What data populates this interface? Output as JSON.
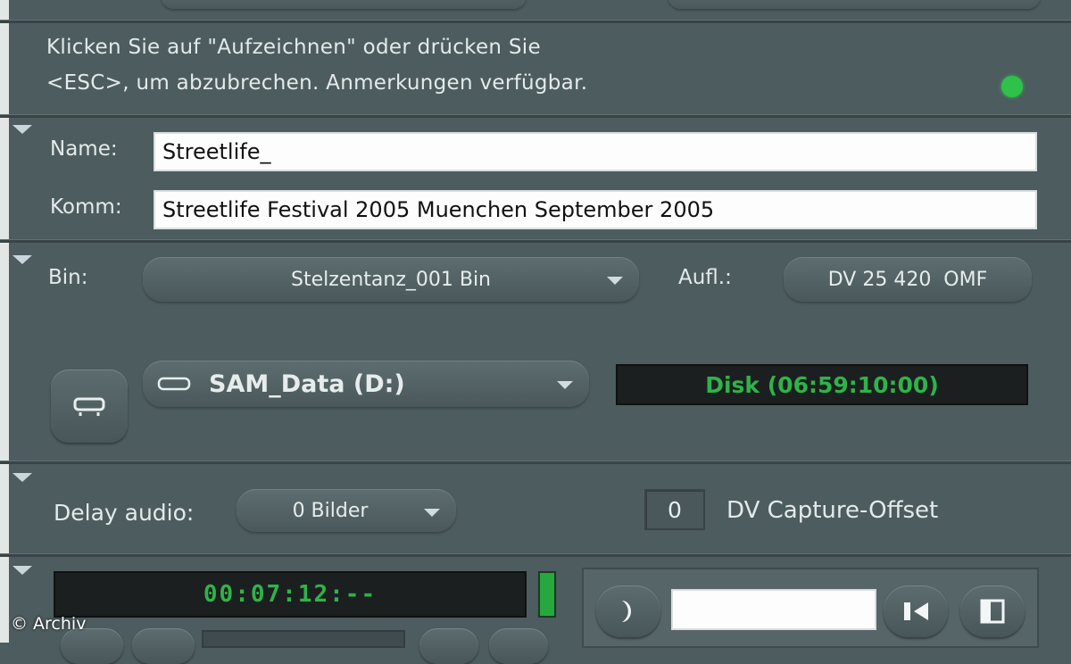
{
  "message": {
    "line1": "Klicken Sie auf \"Aufzeichnen\" oder drücken Sie",
    "line2": "<ESC>, um abzubrechen. Anmerkungen verfügbar."
  },
  "clip": {
    "name_label": "Name:",
    "name_value": "Streetlife_",
    "comment_label": "Komm:",
    "comment_value": "Streetlife Festival 2005 Muenchen September 2005"
  },
  "bin": {
    "label": "Bin:",
    "selected": "Stelzentanz_001 Bin",
    "resolution_label": "Aufl.:",
    "resolution_value": "DV 25 420  OMF"
  },
  "target": {
    "drive_selected": "SAM_Data (D:)",
    "disk_readout": "Disk (06:59:10:00)"
  },
  "audio": {
    "delay_label": "Delay audio:",
    "delay_value": "0 Bilder",
    "offset_value": "0",
    "offset_label": "DV Capture-Offset"
  },
  "deck": {
    "timecode": "00:07:12:--"
  },
  "watermark": "© Archiv",
  "colors": {
    "status_led": "#2fc24a",
    "lcd_text": "#2fb34a"
  }
}
